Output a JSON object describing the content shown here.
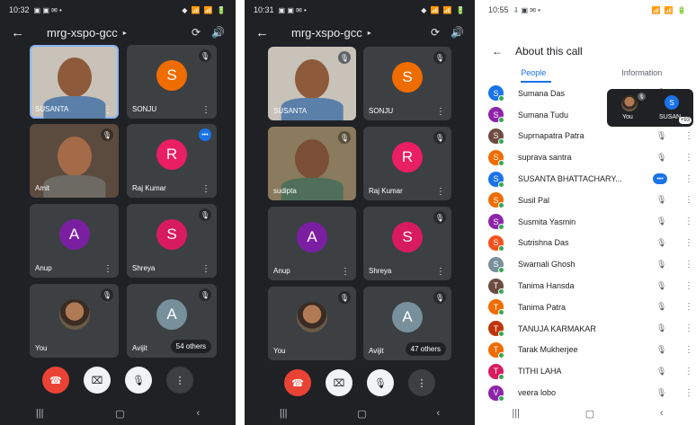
{
  "meeting_code": "mrg-xspo-gcc",
  "left": {
    "time": "10:32",
    "status_icons": "▣ ▣ ✉ •",
    "signal": "◆ 📶 📶 🔋",
    "tiles": [
      {
        "name": "SUSANTA",
        "type": "photo"
      },
      {
        "name": "SONJU",
        "initial": "S"
      },
      {
        "name": "Amit",
        "type": "photo"
      },
      {
        "name": "Raj Kumar",
        "initial": "R"
      },
      {
        "name": "Anup",
        "initial": "A"
      },
      {
        "name": "Shreya",
        "initial": "S"
      },
      {
        "name": "You",
        "type": "photo"
      },
      {
        "name": "Avijit",
        "initial": "A",
        "others": "54 others"
      }
    ]
  },
  "middle": {
    "time": "10:31",
    "status_icons": "▣ ▣ ✉ •",
    "signal": "◆ 📶 📶 🔋",
    "tiles": [
      {
        "name": "SUSANTA",
        "type": "photo"
      },
      {
        "name": "SONJU",
        "initial": "S"
      },
      {
        "name": "sudipta",
        "type": "photo"
      },
      {
        "name": "Raj Kumar",
        "initial": "R"
      },
      {
        "name": "Anup",
        "initial": "A"
      },
      {
        "name": "Shreya",
        "initial": "S"
      },
      {
        "name": "You",
        "type": "photo"
      },
      {
        "name": "Avijit",
        "initial": "A",
        "others": "47 others"
      }
    ]
  },
  "right": {
    "time": "10:55",
    "status_icons": "⇩ ▣ ✉ •",
    "signal": "📶 📶 🔋",
    "title": "About this call",
    "tabs": [
      "People",
      "Information"
    ],
    "people": [
      {
        "name": "Sumana Das",
        "initial": "S",
        "color": "#1a73e8"
      },
      {
        "name": "Sumana Tudu",
        "initial": "S",
        "color": "#8e24aa"
      },
      {
        "name": "Suprnapatra Patra",
        "initial": "S",
        "color": "#6d4c41"
      },
      {
        "name": "suprava santra",
        "initial": "S",
        "color": "#ef6c00"
      },
      {
        "name": "SUSANTA BHATTACHARY...",
        "initial": "S",
        "color": "#1a73e8",
        "speaking": true
      },
      {
        "name": "Susil Pal",
        "initial": "S",
        "color": "#ef6c00"
      },
      {
        "name": "Susmita Yasmin",
        "initial": "S",
        "color": "#8e24aa"
      },
      {
        "name": "Sutrishna Das",
        "initial": "S",
        "color": "#f4511e"
      },
      {
        "name": "Swarnali Ghosh",
        "initial": "S",
        "color": "#78909c"
      },
      {
        "name": "Tanima Hansda",
        "initial": "T",
        "color": "#6d4c41"
      },
      {
        "name": "Tanima Patra",
        "initial": "T",
        "color": "#ef6c00"
      },
      {
        "name": "TANUJA KARMAKAR",
        "initial": "T",
        "color": "#bf360c"
      },
      {
        "name": "Tarak Mukherjee",
        "initial": "T",
        "color": "#ef6c00"
      },
      {
        "name": "TITHI LAHA",
        "initial": "T",
        "color": "#d81b60"
      },
      {
        "name": "veera lobo",
        "initial": "V",
        "color": "#8e24aa"
      }
    ],
    "overlay": {
      "you": "You",
      "other_initial": "S",
      "other": "SUSAN",
      "badge": "+93"
    }
  },
  "icons": {
    "back": "←",
    "chevron": "▸",
    "switch_camera": "⟳",
    "speaker": "🔊",
    "menu": "⋮",
    "mic_off": "🎙",
    "speaking": "•••",
    "end_call": "☎",
    "camera_off": "⌧",
    "mic": "🎙",
    "more": "⋮",
    "nav_recent": "|||",
    "nav_home": "▢",
    "nav_back": "‹"
  }
}
